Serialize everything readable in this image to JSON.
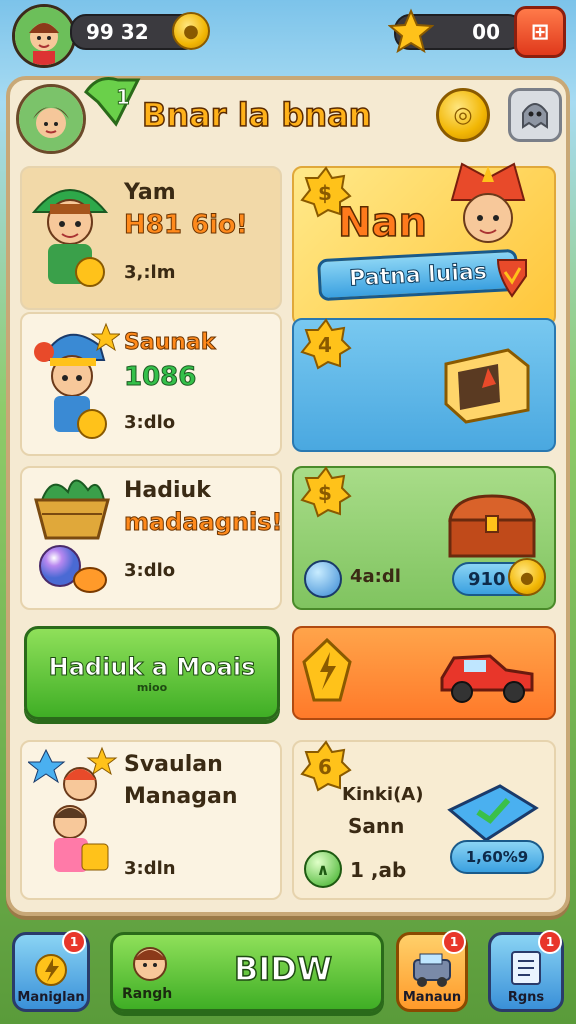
{
  "top_bar": {
    "coins_value": "99 32",
    "stars_value": "00",
    "menu_button_label": "⊞"
  },
  "header": {
    "title": "Bnar la bnan"
  },
  "rows": [
    {
      "title": "Yam",
      "subtitle": "H81 6io!",
      "time": "3,:lm"
    },
    {
      "title": "Saunak",
      "subtitle": "1086",
      "time": "3:dlo"
    },
    {
      "title": "Hadiuk",
      "subtitle": "madaagnis!",
      "time": "3:dlo"
    },
    {
      "title": "Svaulan",
      "subtitle": "Managan",
      "time": "3:dln"
    }
  ],
  "promo": {
    "title": "Nan",
    "banner": "Patna luias"
  },
  "shop_cards": [
    {
      "label": "4a:dl",
      "price": "910"
    },
    {
      "label": "Kinki(A)",
      "sub": "Sann",
      "count": "1 ,ab",
      "price": "1,60%9"
    }
  ],
  "big_button": {
    "label": "Hadiuk a Moais",
    "sub": "mioo"
  },
  "bottom_nav": [
    {
      "label": "Maniglan",
      "badge": "1"
    },
    {
      "label": "Rangh"
    },
    {
      "label": "Manaun",
      "badge": "1"
    },
    {
      "label": "Rgns",
      "badge": "1"
    }
  ],
  "bottom_nav_main": {
    "label": "BIDW"
  },
  "colors": {
    "panel": "#f5ead2",
    "accent_green": "#3fae25",
    "accent_orange": "#ff8a1c",
    "accent_blue": "#5ab8e8"
  }
}
